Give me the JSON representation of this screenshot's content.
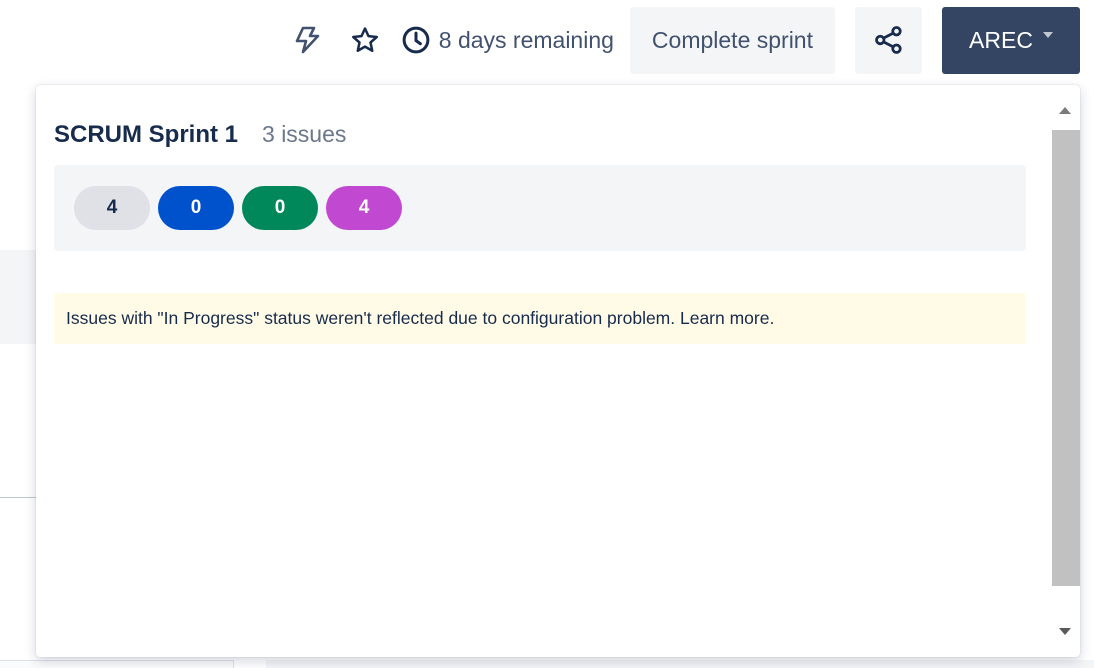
{
  "header": {
    "time_remaining": "8 days remaining",
    "complete_sprint_label": "Complete sprint",
    "user_menu_label": "AREC",
    "icons": [
      "automation-icon",
      "star-icon",
      "clock-icon",
      "share-icon",
      "chevron-down-icon"
    ]
  },
  "popover": {
    "sprint_name": "SCRUM Sprint 1",
    "issue_count": "3 issues",
    "status_counts": [
      {
        "label": "4",
        "status": "todo",
        "color": "#dfe1e6"
      },
      {
        "label": "0",
        "status": "in-progress",
        "color": "#0052cc"
      },
      {
        "label": "0",
        "status": "done",
        "color": "#00875a"
      },
      {
        "label": "4",
        "status": "other",
        "color": "#c149d2"
      }
    ],
    "warning_text": "Issues with \"In Progress\" status weren't reflected due to configuration problem. Learn more."
  },
  "colors": {
    "accent": "#344563",
    "panel_bg": "#f4f5f7",
    "warning_bg": "#fffbe6"
  }
}
